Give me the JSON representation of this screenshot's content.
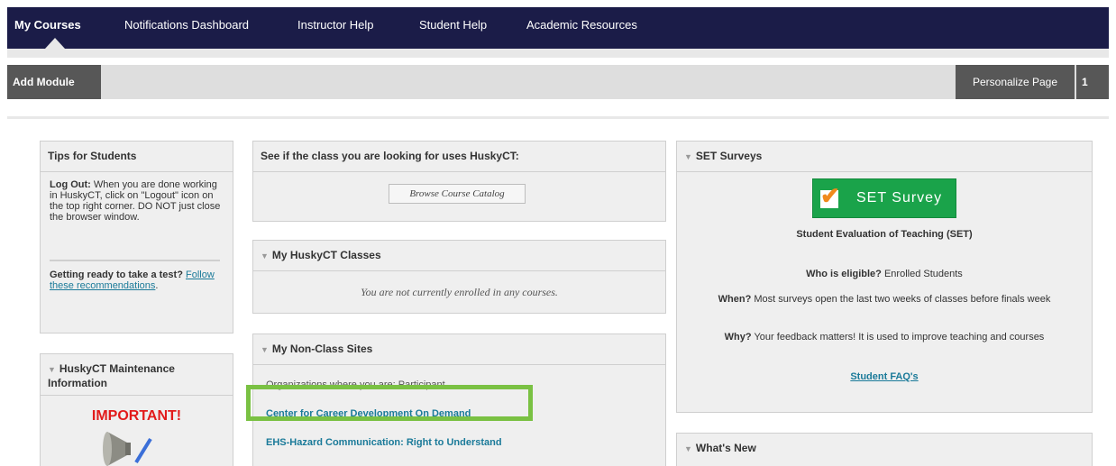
{
  "nav": {
    "tabs": [
      "My Courses",
      "Notifications Dashboard",
      "Instructor Help",
      "Student Help",
      "Academic Resources"
    ]
  },
  "toolbar": {
    "add_module": "Add Module",
    "personalize": "Personalize Page",
    "extra": "1"
  },
  "tips": {
    "title": "Tips for Students",
    "logout_label": "Log Out:",
    "logout_text": "When you are done working in HuskyCT, click on \"Logout\" icon on the top right corner. DO NOT just close the browser window.",
    "test_label": "Getting ready to take a test?",
    "test_link": "Follow these recommendations",
    "test_end": "."
  },
  "maintenance": {
    "title": "HuskyCT Maintenance Information",
    "important": "IMPORTANT!"
  },
  "catalog": {
    "title": "See if the class you are looking for uses HuskyCT:",
    "button": "Browse Course Catalog"
  },
  "classes": {
    "title": "My HuskyCT Classes",
    "message": "You are not currently enrolled in any courses."
  },
  "nonclass": {
    "title": "My Non-Class Sites",
    "subhead": "Organizations where you are: Participant",
    "links": [
      "Center for Career Development On Demand",
      "EHS-Hazard Communication: Right to Understand"
    ]
  },
  "set": {
    "title": "SET Surveys",
    "button": "SET Survey",
    "heading": "Student Evaluation of Teaching (SET)",
    "who_q": "Who is eligible?",
    "who_a": "Enrolled Students",
    "when_q": "When?",
    "when_a": "Most surveys open the last two weeks of classes before finals week",
    "why_q": "Why?",
    "why_a": "Your feedback matters! It is used to improve teaching and courses",
    "faq": "Student FAQ's"
  },
  "whatsnew": {
    "title": "What's New"
  },
  "colors": {
    "nav_bg": "#1b1c48",
    "toolbar_dark": "#575757",
    "link": "#1a7a99",
    "important": "#e21b1b",
    "set_green": "#1aa34a",
    "highlight": "#7ac143"
  }
}
